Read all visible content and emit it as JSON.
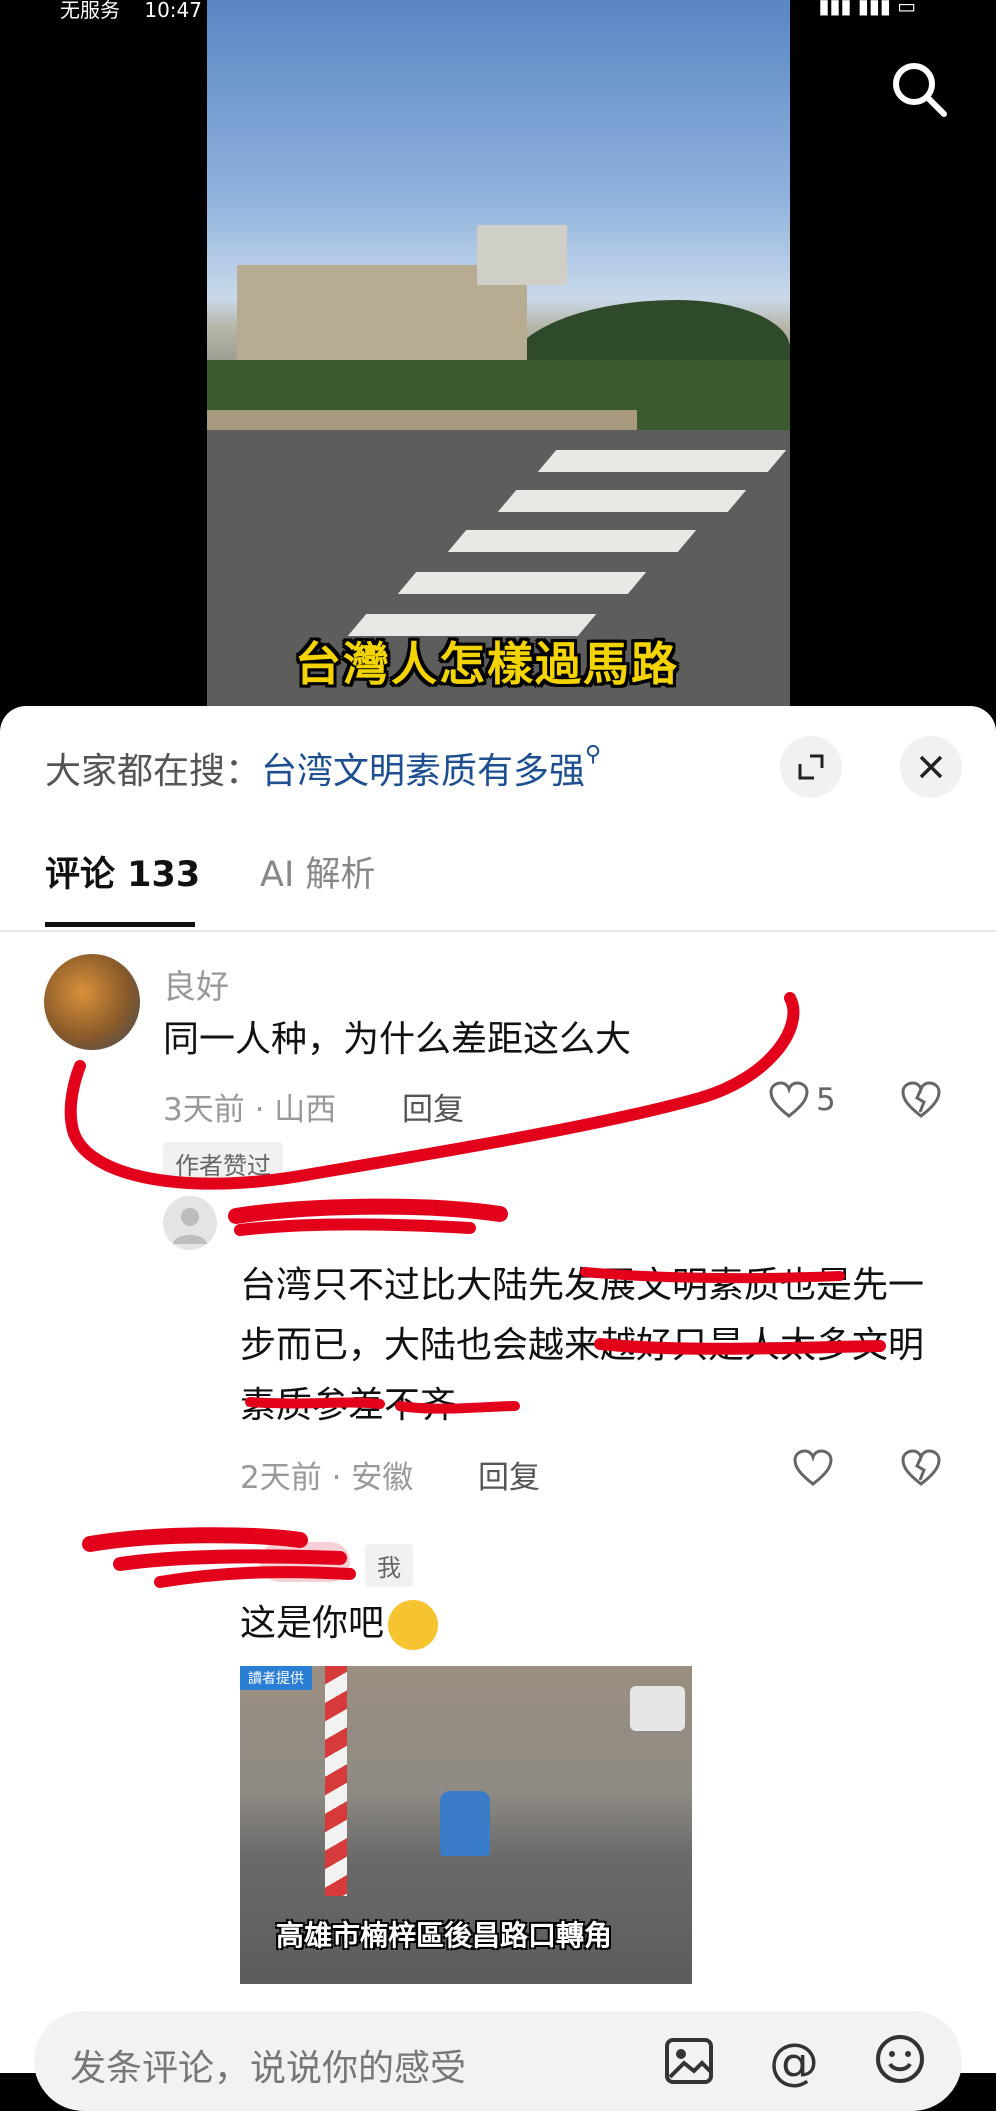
{
  "status_bar": {
    "carrier": "无服务",
    "time": "10:47"
  },
  "video": {
    "caption": "台灣人怎樣過馬路"
  },
  "hot_search": {
    "prefix": "大家都在搜：",
    "term": "台湾文明素质有多强"
  },
  "tabs": [
    {
      "label": "评论 133",
      "active": true
    },
    {
      "label": "AI 解析",
      "active": false
    }
  ],
  "comments": [
    {
      "username": "良好",
      "text": "同一人种，为什么差距这么大",
      "time_location": "3天前 · 山西",
      "reply_label": "回复",
      "likes": "5",
      "badge": "作者赞过"
    },
    {
      "text": "台湾只不过比大陆先发展文明素质也是先一步而已，大陆也会越来越好只是人太多文明素质参差不齐",
      "time_location": "2天前 · 安徽",
      "reply_label": "回复"
    },
    {
      "badge": "我",
      "text": "这是你吧",
      "image_caption": "高雄市楠梓區後昌路口轉角",
      "image_tag": "讀者提供"
    }
  ],
  "bottom_bar": {
    "placeholder": "发条评论，说说你的感受"
  },
  "colors": {
    "link_blue": "#1d4f91",
    "caption_yellow": "#f3d400",
    "scribble_red": "#e3001b"
  }
}
